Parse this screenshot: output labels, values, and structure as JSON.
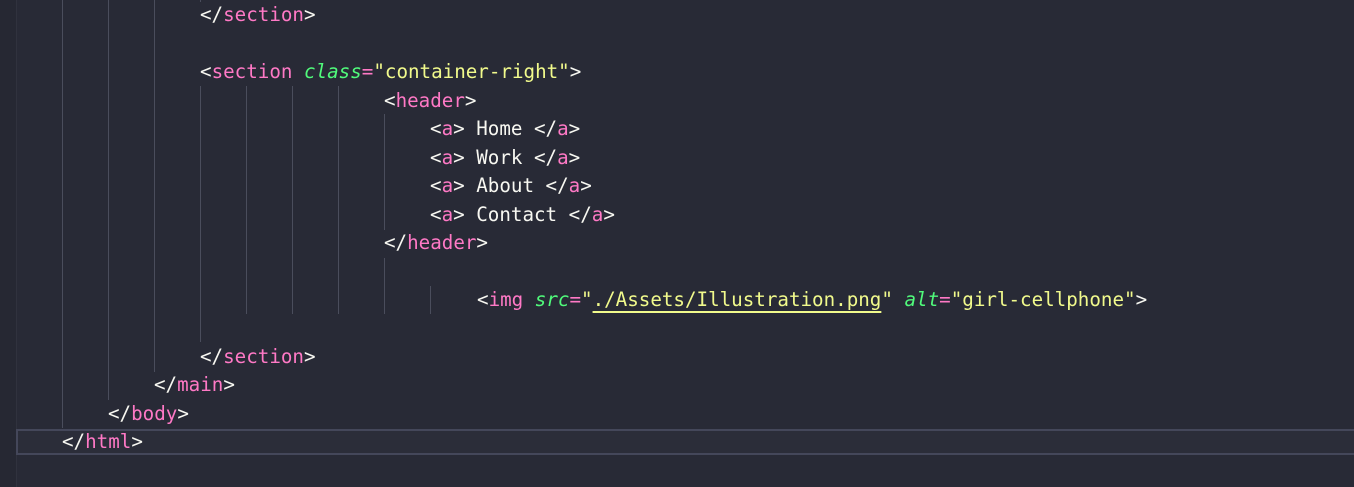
{
  "theme": {
    "background": "#282a36",
    "tag_color": "#ff79c6",
    "attribute_color": "#50fa7b",
    "string_color": "#f1fa8c",
    "text_color": "#f8f8f2",
    "guide_color": "#4a4d5c",
    "current_line_border": "#44475a"
  },
  "code": {
    "line1": {
      "close_open": "</",
      "tag": "section",
      "close": ">"
    },
    "line2": {
      "open": "<",
      "tag": "section",
      "attr": "class",
      "eq": "=",
      "quote_open": "\"",
      "value": "container-right",
      "quote_close": "\"",
      "close": ">"
    },
    "line3": {
      "open": "<",
      "tag": "header",
      "close": ">"
    },
    "nav_items": [
      {
        "open": "<",
        "tag": "a",
        "mid": "> ",
        "text": "Home",
        "end_open": " </",
        "end_tag": "a",
        "end_close": ">"
      },
      {
        "open": "<",
        "tag": "a",
        "mid": "> ",
        "text": "Work",
        "end_open": " </",
        "end_tag": "a",
        "end_close": ">"
      },
      {
        "open": "<",
        "tag": "a",
        "mid": "> ",
        "text": "About",
        "end_open": " </",
        "end_tag": "a",
        "end_close": ">"
      },
      {
        "open": "<",
        "tag": "a",
        "mid": "> ",
        "text": "Contact",
        "end_open": " </",
        "end_tag": "a",
        "end_close": ">"
      }
    ],
    "line8": {
      "close_open": "</",
      "tag": "header",
      "close": ">"
    },
    "img_line": {
      "open": "<",
      "tag": "img",
      "attr1": "src",
      "eq1": "=",
      "q1o": "\"",
      "value1": "./Assets/Illustration.png",
      "q1c": "\"",
      "attr2": "alt",
      "eq2": "=",
      "q2o": "\"",
      "value2": "girl-cellphone",
      "q2c": "\"",
      "close": ">"
    },
    "section_close": {
      "close_open": "</",
      "tag": "section",
      "close": ">"
    },
    "main_close": {
      "close_open": "</",
      "tag": "main",
      "close": ">"
    },
    "body_close": {
      "close_open": "</",
      "tag": "body",
      "close": ">"
    },
    "html_close": {
      "close_open": "</",
      "tag": "html",
      "close": ">"
    }
  }
}
